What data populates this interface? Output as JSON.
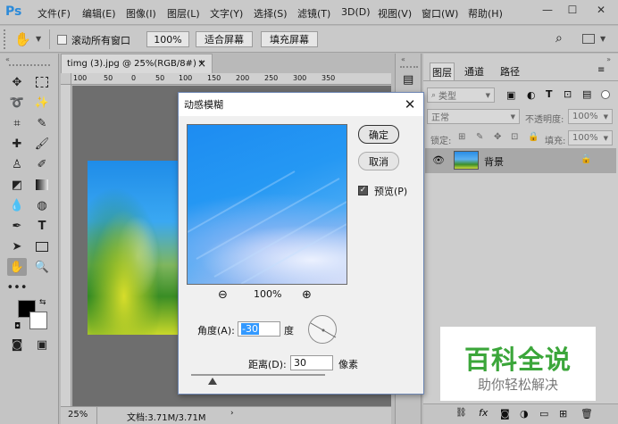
{
  "app": {
    "logo": "Ps"
  },
  "menu": [
    "文件(F)",
    "编辑(E)",
    "图像(I)",
    "图层(L)",
    "文字(Y)",
    "选择(S)",
    "滤镜(T)",
    "3D(D)",
    "视图(V)",
    "窗口(W)",
    "帮助(H)"
  ],
  "window_controls": {
    "minimize": "—",
    "maximize": "☐",
    "close": "✕"
  },
  "options": {
    "scroll_all_label": "滚动所有窗口",
    "zoom_btn": "100%",
    "fit_screen": "适合屏幕",
    "fill_screen": "填充屏幕"
  },
  "document": {
    "tab_title": "timg (3).jpg @ 25%(RGB/8#) *",
    "tab_close": "×",
    "ruler_ticks": [
      "100",
      "50",
      "0",
      "50",
      "100",
      "150",
      "200",
      "250",
      "300",
      "350"
    ],
    "zoom": "25%",
    "doc_info": "文档:3.71M/3.71M"
  },
  "layers_panel": {
    "tabs": [
      "图层",
      "通道",
      "路径"
    ],
    "kind_filter": "类型",
    "blend_mode": "正常",
    "opacity_label": "不透明度:",
    "opacity_value": "100%",
    "lock_label": "锁定:",
    "fill_label": "填充:",
    "fill_value": "100%",
    "layer_name": "背景"
  },
  "dialog": {
    "title": "动感模糊",
    "ok": "确定",
    "cancel": "取消",
    "preview_label": "预览(P)",
    "preview_checked": true,
    "zoom_level": "100%",
    "angle_label": "角度(A):",
    "angle_value": "-30",
    "angle_unit": "度",
    "distance_label": "距离(D):",
    "distance_value": "30",
    "distance_unit": "像素"
  },
  "watermark": {
    "title": "百科全说",
    "subtitle": "助你轻松解决"
  },
  "colors": {
    "foreground": "#000000",
    "background": "#ffffff",
    "watermark_green": "#3ba63a",
    "ps_blue": "#2b8ad9"
  }
}
